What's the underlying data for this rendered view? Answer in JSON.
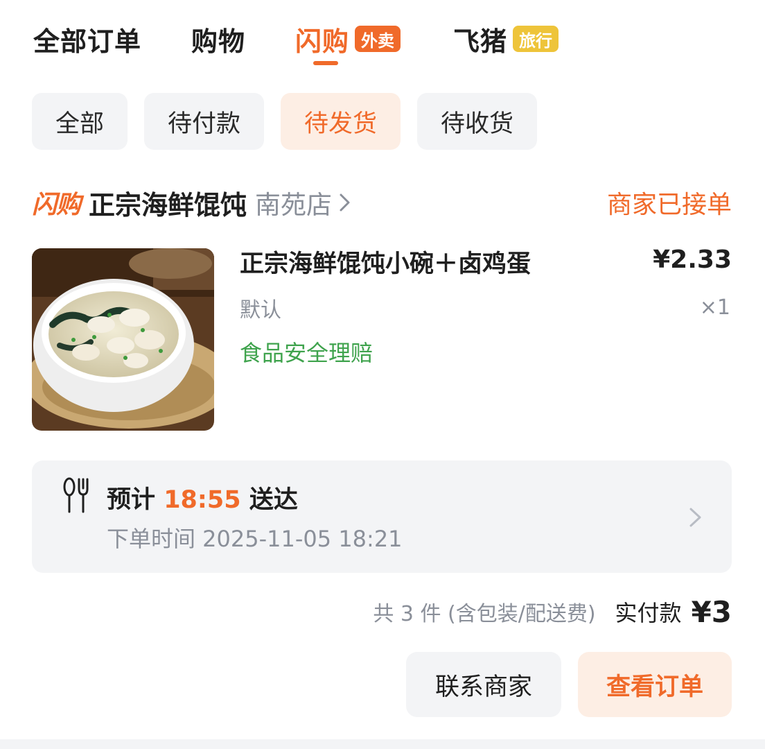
{
  "tabs": [
    {
      "label": "全部订单",
      "badge": null,
      "active": false
    },
    {
      "label": "购物",
      "badge": null,
      "active": false
    },
    {
      "label": "闪购",
      "badge": "外卖",
      "active": true
    },
    {
      "label": "飞猪",
      "badge": "旅行",
      "active": false
    }
  ],
  "filters": [
    {
      "label": "全部",
      "active": false
    },
    {
      "label": "待付款",
      "active": false
    },
    {
      "label": "待发货",
      "active": true
    },
    {
      "label": "待收货",
      "active": false
    }
  ],
  "order": {
    "platform_logo": "闪购",
    "shop_name": "正宗海鲜馄饨",
    "shop_branch": "南苑店",
    "status": "商家已接单",
    "item": {
      "title": "正宗海鲜馄饨小碗＋卤鸡蛋",
      "price": "¥2.33",
      "variant": "默认",
      "quantity": "×1",
      "tag": "食品安全理赔"
    },
    "delivery": {
      "eta_prefix": "预计",
      "eta_time": "18:55",
      "eta_suffix": "送达",
      "order_time": "下单时间 2025-11-05 18:21"
    },
    "totals": {
      "count_text": "共 3 件 (含包装/配送费)",
      "paid_label": "实付款",
      "paid_amount": "¥3"
    },
    "actions": {
      "contact": "联系商家",
      "view": "查看订单"
    }
  },
  "colors": {
    "accent": "#f06a2a",
    "badge_yellow": "#eec43a",
    "green": "#3fa34d",
    "chip_bg": "#f3f4f6",
    "chip_active_bg": "#fdeee4"
  },
  "icons": [
    "chevron-right-icon",
    "cutlery-icon",
    "food-photo"
  ]
}
